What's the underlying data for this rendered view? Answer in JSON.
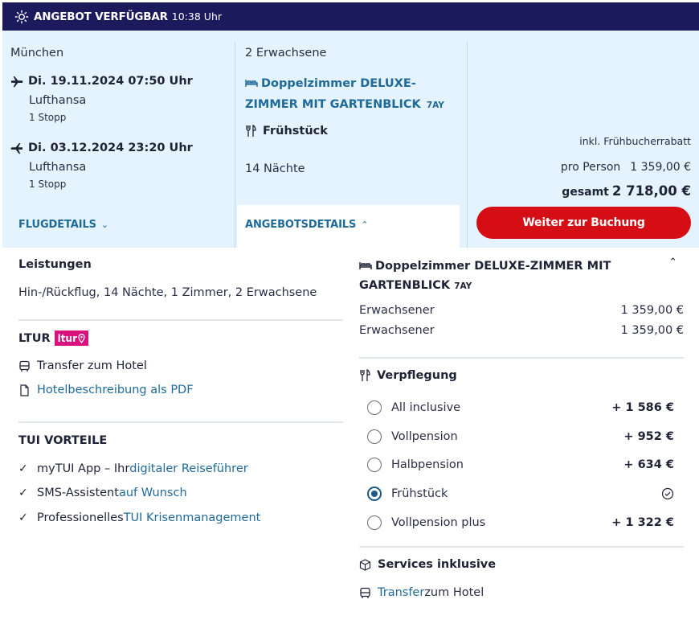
{
  "banner": {
    "title": "ANGEBOT VERFÜGBAR",
    "time": "10:38 Uhr",
    "icon": "sun-icon"
  },
  "flights": {
    "departure_city": "München",
    "outbound": {
      "date": "Di. 19.11.2024 07:50 Uhr",
      "airline": "Lufthansa",
      "stops": "1 Stopp"
    },
    "return": {
      "date": "Di. 03.12.2024 23:20 Uhr",
      "airline": "Lufthansa",
      "stops": "1 Stopp"
    },
    "details_link": "FLUGDETAILS"
  },
  "offer": {
    "persons": "2 Erwachsene",
    "room": "Doppelzimmer DELUXE-ZIMMER MIT GARTENBLICK",
    "room_code": "7AY",
    "board": "Frühstück",
    "nights": "14 Nächte",
    "details_link": "ANGEBOTSDETAILS"
  },
  "pricing": {
    "discount_note": "inkl. Frühbucherrabatt",
    "per_person_label": "pro Person",
    "per_person_value": "1 359,00 €",
    "total_label": "gesamt",
    "total_value": "2 718,00 €",
    "cta_label": "Weiter zur Buchung",
    "accent_color": "#d40e14"
  },
  "details": {
    "leistungen_title": "Leistungen",
    "leistungen_text": "Hin-/Rückflug, 14 Nächte, 1 Zimmer, 2 Erwachsene",
    "ltur_title": "LTUR",
    "ltur_badge": "ltur",
    "transfer": "Transfer zum Hotel",
    "pdf_link": "Hotelbeschreibung als PDF",
    "vorteile_title": "TUI VORTEILE",
    "vorteile": [
      {
        "a": "myTUI App – Ihr ",
        "b": "digitaler Reiseführer"
      },
      {
        "a": "SMS-Assistent ",
        "b": "auf Wunsch"
      },
      {
        "a": "Professionelles ",
        "b": "TUI Krisenmanagement"
      }
    ],
    "room_title": "Doppelzimmer DELUXE-ZIMMER MIT GARTENBLICK",
    "room_code": "7AY",
    "travellers": [
      {
        "label": "Erwachsener",
        "price": "1 359,00 €"
      },
      {
        "label": "Erwachsener",
        "price": "1 359,00 €"
      }
    ],
    "verpflegung_title": "Verpflegung",
    "board_options": [
      {
        "label": "All inclusive",
        "price": "+ 1 586 €",
        "selected": false
      },
      {
        "label": "Vollpension",
        "price": "+ 952 €",
        "selected": false
      },
      {
        "label": "Halbpension",
        "price": "+ 634 €",
        "selected": false
      },
      {
        "label": "Frühstück",
        "price": "",
        "selected": true
      },
      {
        "label": "Vollpension plus",
        "price": "+ 1 322 €",
        "selected": false
      }
    ],
    "services_title": "Services inklusive",
    "services_transfer_a": "Transfer",
    "services_transfer_b": " zum Hotel"
  }
}
